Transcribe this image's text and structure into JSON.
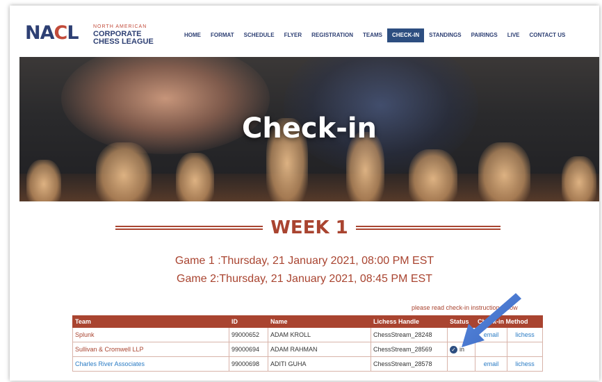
{
  "header": {
    "logo": {
      "mark_a": "NA",
      "mark_c": "C",
      "mark_b": "L",
      "small": "NORTH AMERICAN",
      "line1": "CORPORATE",
      "line2": "CHESS LEAGUE"
    },
    "nav": [
      "HOME",
      "FORMAT",
      "SCHEDULE",
      "FLYER",
      "REGISTRATION",
      "TEAMS",
      "CHECK-IN",
      "STANDINGS",
      "PAIRINGS",
      "LIVE",
      "CONTACT US"
    ],
    "active_nav": "CHECK-IN"
  },
  "hero": {
    "title": "Check-in"
  },
  "week": {
    "title": "WEEK 1"
  },
  "games": {
    "game1": "Game 1 :Thursday, 21 January 2021, 08:00 PM EST",
    "game2": "Game 2:Thursday, 21 January 2021, 08:45 PM EST"
  },
  "note": "please read check-in instruction below",
  "table": {
    "headers": [
      "Team",
      "ID",
      "Name",
      "Lichess Handle",
      "Status",
      "Check-in Method"
    ],
    "rows": [
      {
        "team": "Splunk",
        "id": "99000652",
        "name": "ADAM KROLL",
        "handle": "ChessStream_28248",
        "status": "",
        "email": "email",
        "lichess": "lichess"
      },
      {
        "team": "Sullivan & Cromwell LLP",
        "id": "99000694",
        "name": "ADAM RAHMAN",
        "handle": "ChessStream_28569",
        "status": "in",
        "email": "",
        "lichess": ""
      },
      {
        "team": "Charles River Associates",
        "id": "99000698",
        "name": "ADITI GUHA",
        "handle": "ChessStream_28578",
        "status": "",
        "email": "email",
        "lichess": "lichess"
      }
    ]
  },
  "colors": {
    "brand_red": "#a94430",
    "brand_navy": "#2d4e80",
    "link_blue": "#2a7bc4",
    "annotation_arrow": "#4a78d0"
  },
  "icons": {
    "status_in": "check-circle-icon",
    "annotation": "arrow-pointer-icon"
  }
}
